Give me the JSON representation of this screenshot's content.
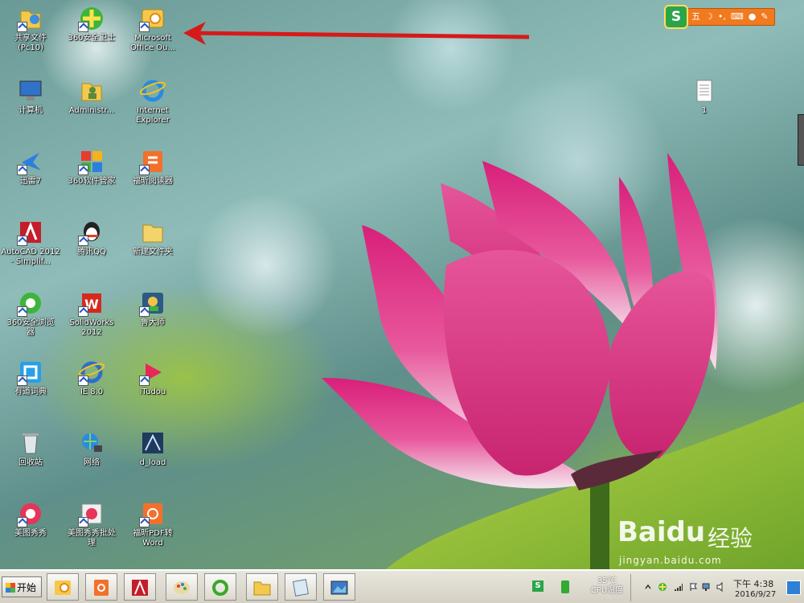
{
  "desktop": {
    "icons": [
      {
        "label": "共享文件\n(Pc10)",
        "icon": "shared-folder-icon"
      },
      {
        "label": "360安全卫士",
        "icon": "360-security-icon"
      },
      {
        "label": "Microsoft\nOffice Ou...",
        "icon": "outlook-icon"
      },
      {
        "label": "计算机",
        "icon": "computer-icon"
      },
      {
        "label": "Administr...",
        "icon": "user-folder-icon"
      },
      {
        "label": "Internet\nExplorer",
        "icon": "ie-icon"
      },
      {
        "label": "迅雷7",
        "icon": "thunder-icon"
      },
      {
        "label": "360软件管家",
        "icon": "360-software-icon"
      },
      {
        "label": "福昕阅读器",
        "icon": "foxit-reader-icon"
      },
      {
        "label": "AutoCAD 2012\n- Simplif...",
        "icon": "autocad-icon"
      },
      {
        "label": "腾讯QQ",
        "icon": "qq-icon"
      },
      {
        "label": "新建文件夹",
        "icon": "new-folder-icon"
      },
      {
        "label": "360安全浏览\n器",
        "icon": "360-browser-icon"
      },
      {
        "label": "SolidWorks\n2012",
        "icon": "solidworks-icon"
      },
      {
        "label": "鲁大师",
        "icon": "ludashi-icon"
      },
      {
        "label": "有道词典",
        "icon": "youdao-icon"
      },
      {
        "label": "IE 8.0",
        "icon": "ie8-icon"
      },
      {
        "label": "iTudou",
        "icon": "itudou-icon"
      },
      {
        "label": "回收站",
        "icon": "recycle-bin-icon"
      },
      {
        "label": "网络",
        "icon": "network-icon"
      },
      {
        "label": "d_load",
        "icon": "download-icon"
      },
      {
        "label": "美图秀秀",
        "icon": "meitu-icon"
      },
      {
        "label": "美图秀秀批处\n理",
        "icon": "meitu-batch-icon"
      },
      {
        "label": "福昕PDF转\nWord",
        "icon": "foxit-pdf-word-icon"
      },
      {
        "label": "1",
        "icon": "text-file-icon"
      }
    ]
  },
  "ime_bar": {
    "logo": "S",
    "mode": "五",
    "icon": "sogou-ime-icon"
  },
  "taskbar": {
    "start_label": "开始",
    "quick_launch": [
      "outlook-icon",
      "foxit-pdf-icon",
      "autocad-icon",
      "paint-icon",
      "ie-icon",
      "folder-icon",
      "notepad-icon",
      "desktop-image-icon"
    ],
    "tray": {
      "cpu_temp": "35℃",
      "cpu_label": "CPU温度",
      "time": "下午 4:38",
      "date": "2016/9/27"
    }
  },
  "watermark": {
    "main": "Bai",
    "main2": "du",
    "cn": "经验",
    "sub": "jingyan.baidu.com"
  },
  "colors": {
    "arrow": "#d61a1a",
    "lotus": "#e23a8a",
    "taskbar": "#d4d0c4"
  }
}
